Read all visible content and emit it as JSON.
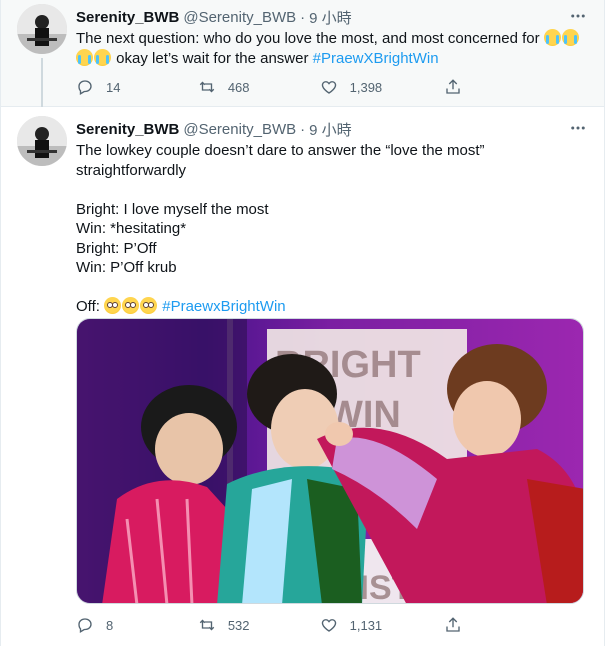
{
  "tweets": [
    {
      "name": "Serenity_BWB",
      "handle": "@Serenity_BWB",
      "dot": "·",
      "time": "9 小時",
      "text_lines": [
        {
          "text": "The next question: who do you love the most, and most concerned for "
        },
        {
          "text": " okay let’s wait for the answer "
        },
        {
          "hashtag": "#PraewXBrightWin"
        }
      ],
      "replies": "14",
      "retweets": "468",
      "likes": "1,398"
    },
    {
      "name": "Serenity_BWB",
      "handle": "@Serenity_BWB",
      "dot": "·",
      "time": "9 小時",
      "lines": [
        "The lowkey couple doesn’t dare to answer the “love the most”",
        "straightforwardly",
        "",
        "Bright: I love myself the most",
        "Win: *hesitating*",
        "Bright: P’Off",
        "Win: P’Off krub",
        "",
        "Off: "
      ],
      "hashtag": "#PraewxBrightWin",
      "media_text": {
        "sign_line1": "BRIGHT",
        "sign_line2": "WIN",
        "sign_bottom": "RIST"
      },
      "replies": "8",
      "retweets": "532",
      "likes": "1,131"
    }
  ],
  "icons": {
    "more": "more-horizontal-icon",
    "reply": "reply-icon",
    "retweet": "retweet-icon",
    "like": "heart-icon",
    "share": "share-icon"
  },
  "colors": {
    "link": "#1d9bf0",
    "muted": "#536471",
    "stage_purple": "#7b1fa2"
  }
}
